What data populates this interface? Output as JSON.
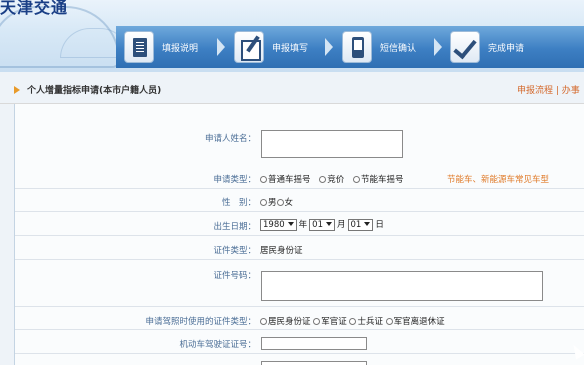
{
  "banner": {
    "logo_text": "天津交通",
    "steps": [
      {
        "label": "填报说明",
        "icon": "document-icon"
      },
      {
        "label": "申报填写",
        "icon": "edit-form-icon"
      },
      {
        "label": "短信确认",
        "icon": "mobile-phone-icon"
      },
      {
        "label": "完成申请",
        "icon": "checkmark-icon"
      }
    ]
  },
  "section": {
    "title": "个人增量指标申请(本市户籍人员)",
    "links": "申报流程 | 办事"
  },
  "form": {
    "name_label": "申请人姓名：",
    "type_label": "申请类型：",
    "type_options": [
      "普通车摇号",
      "竞价",
      "节能车摇号"
    ],
    "type_hint": "节能车、新能源车常见车型",
    "gender_label": "性　别：",
    "gender_options": [
      "男",
      "女"
    ],
    "birth_label": "出生日期：",
    "birth_year": "1980",
    "birth_month": "01",
    "birth_day": "01",
    "unit_year": "年",
    "unit_month": "月",
    "unit_day": "日",
    "idtype_label": "证件类型：",
    "idtype_value": "居民身份证",
    "idnum_label": "证件号码：",
    "license_idtype_label": "申请驾照时使用的证件类型：",
    "license_idtype_options": [
      "居民身份证",
      "军官证",
      "士兵证",
      "军官离退休证"
    ],
    "license_num_label": "机动车驾驶证证号："
  },
  "colors": {
    "accent_orange": "#e07b2a",
    "label_blue": "#4b6e96",
    "step_bar_blue": "#3d7fc3"
  }
}
